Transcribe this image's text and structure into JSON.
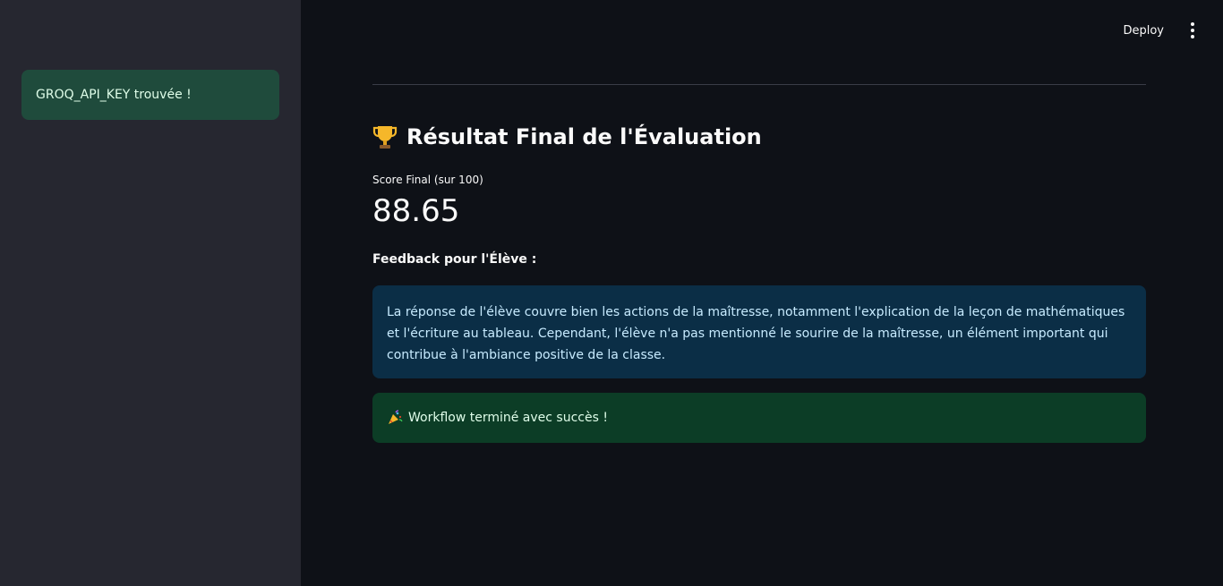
{
  "sidebar": {
    "alert_text": "GROQ_API_KEY trouvée !"
  },
  "header": {
    "deploy_label": "Deploy",
    "menu_icon": "vertical-ellipsis-icon"
  },
  "main": {
    "title": "Résultat Final de l'Évaluation",
    "title_icon": "trophy-icon",
    "metric": {
      "label": "Score Final (sur 100)",
      "value": "88.65"
    },
    "feedback_heading": "Feedback pour l'Élève :",
    "feedback_text": "La réponse de l'élève couvre bien les actions de la maîtresse, notamment l'explication de la leçon de mathématiques et l'écriture au tableau. Cependant, l'élève n'a pas mentionné le sourire de la maîtresse, un élément important qui contribue à l'ambiance positive de la classe.",
    "success_icon": "party-popper-icon",
    "success_text": "Workflow terminé avec succès !"
  },
  "colors": {
    "background": "#0e1117",
    "sidebar": "#262730",
    "info_bg": "#0b2e46",
    "success_bg": "#0c3d26",
    "sidebar_success_bg": "#1f4b3c"
  }
}
